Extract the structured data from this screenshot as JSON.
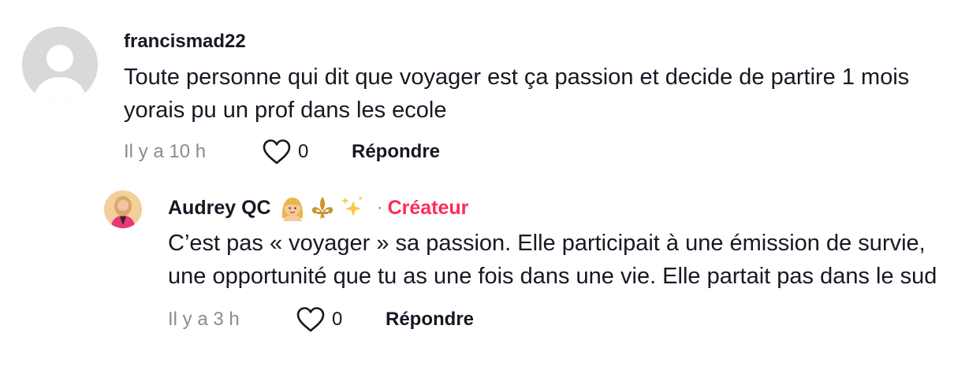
{
  "comments": [
    {
      "username": "francismad22",
      "text": "Toute personne qui dit que voyager est ça passion et decide de partire 1 mois yorais pu un prof dans les ecole",
      "time": "Il y a 10 h",
      "likes": "0",
      "reply_label": "Répondre"
    }
  ],
  "reply": {
    "username": "Audrey QC",
    "emojis": [
      "person-blond-hair-emoji",
      "fleur-de-lis-emoji",
      "sparkles-emoji"
    ],
    "separator": "·",
    "badge": "Créateur",
    "text": "C’est pas « voyager » sa passion. Elle participait à une émission de survie, une opportunité que tu as une fois dans une vie. Elle partait pas dans le sud",
    "time": "Il y a 3 h",
    "likes": "0",
    "reply_label": "Répondre"
  },
  "colors": {
    "text": "#161823",
    "muted": "#8a8b91",
    "creator": "#fe2c55",
    "placeholder_avatar": "#d9d9d9"
  }
}
